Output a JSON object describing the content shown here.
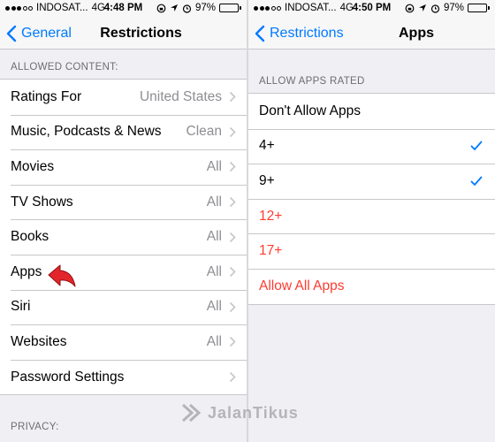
{
  "left": {
    "status": {
      "carrier": "INDOSAT...",
      "network": "4G",
      "time": "4:48 PM",
      "battery": "97%",
      "battery_level": 0.97
    },
    "nav": {
      "back_label": "General",
      "title": "Restrictions"
    },
    "section_allowed": "ALLOWED CONTENT:",
    "rows": [
      {
        "label": "Ratings For",
        "detail": "United States"
      },
      {
        "label": "Music, Podcasts & News",
        "detail": "Clean"
      },
      {
        "label": "Movies",
        "detail": "All"
      },
      {
        "label": "TV Shows",
        "detail": "All"
      },
      {
        "label": "Books",
        "detail": "All"
      },
      {
        "label": "Apps",
        "detail": "All"
      },
      {
        "label": "Siri",
        "detail": "All"
      },
      {
        "label": "Websites",
        "detail": "All"
      },
      {
        "label": "Password Settings",
        "detail": ""
      }
    ],
    "section_privacy": "PRIVACY:"
  },
  "right": {
    "status": {
      "carrier": "INDOSAT...",
      "network": "4G",
      "time": "4:50 PM",
      "battery": "97%",
      "battery_level": 0.97
    },
    "nav": {
      "back_label": "Restrictions",
      "title": "Apps"
    },
    "section_header": "ALLOW APPS RATED",
    "rows": [
      {
        "label": "Don't Allow Apps",
        "checked": false,
        "color": "#000000"
      },
      {
        "label": "4+",
        "checked": true,
        "color": "#000000"
      },
      {
        "label": "9+",
        "checked": true,
        "color": "#000000"
      },
      {
        "label": "12+",
        "checked": false,
        "color": "#ff3b30"
      },
      {
        "label": "17+",
        "checked": false,
        "color": "#ff3b30"
      },
      {
        "label": "Allow All Apps",
        "checked": false,
        "color": "#ff3b30"
      }
    ]
  },
  "watermark": {
    "text": "JalanTikus",
    "icon": "jalantikus-logo-icon"
  },
  "colors": {
    "accent": "#007aff",
    "destructive": "#ff3b30",
    "battery": "#4cd964",
    "checkmark": "#007aff"
  },
  "icons": {
    "chevron": "chevron-right-icon",
    "back": "chevron-left-icon",
    "check": "checkmark-icon",
    "pointer": "red-arrow-pointer-icon"
  }
}
